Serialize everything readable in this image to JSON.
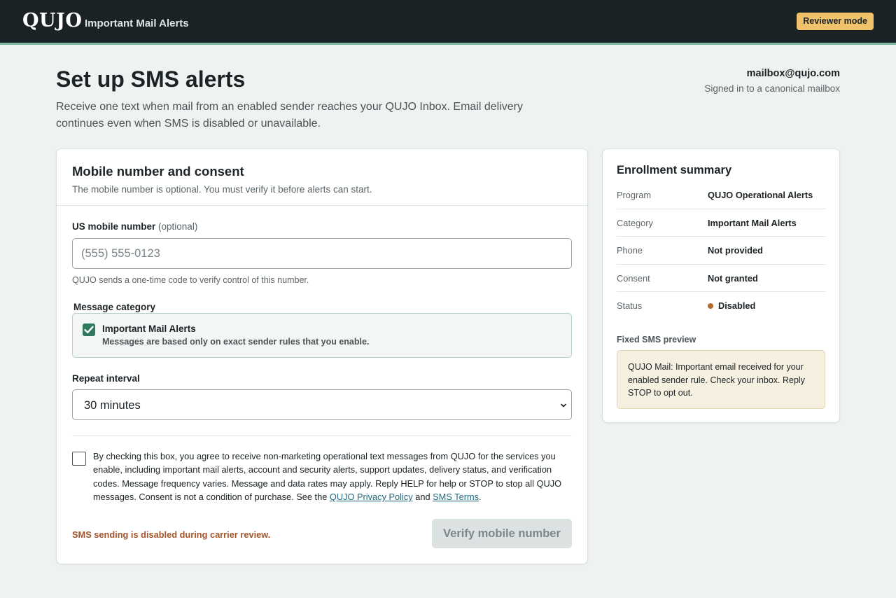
{
  "header": {
    "logo": "QUJO",
    "app_name": "Important Mail Alerts",
    "reviewer_badge": "Reviewer mode",
    "colors": {
      "bar": "#1a2226",
      "accent": "#7fb5a2",
      "badge": "#f0c36b"
    }
  },
  "page": {
    "title": "Set up SMS alerts",
    "description": "Receive one text when mail from an enabled sender reaches your QUJO Inbox. Email delivery continues even when SMS is disabled or unavailable."
  },
  "account": {
    "email": "mailbox@qujo.com",
    "subtitle": "Signed in to a canonical mailbox"
  },
  "form": {
    "title": "Mobile number and consent",
    "subtitle": "The mobile number is optional. You must verify it before alerts can start.",
    "phone_label": "US mobile number",
    "phone_optional": "(optional)",
    "phone_value": "",
    "phone_placeholder": "(555) 555-0123",
    "phone_hint": "QUJO sends a one-time code to verify control of this number.",
    "category_label": "Message category",
    "category": {
      "checked": true,
      "title": "Important Mail Alerts",
      "description": "Messages are based only on exact sender rules that you enable.",
      "check_color": "#2f7a5c"
    },
    "interval_label": "Repeat interval",
    "interval_value": "30 minutes",
    "consent": {
      "checked": false,
      "text_before": "By checking this box, you agree to receive non-marketing operational text messages from QUJO for the services you enable, including important mail alerts, account and security alerts, support updates, delivery status, and verification codes. Message frequency varies. Message and data rates may apply. Reply HELP for help or STOP to stop all QUJO messages. Consent is not a condition of purchase. See the ",
      "privacy_link": "QUJO Privacy Policy",
      "between": " and ",
      "terms_link": "SMS Terms",
      "end": "."
    },
    "warning": "SMS sending is disabled during carrier review.",
    "warning_color": "#a4542a",
    "verify_button": "Verify mobile number"
  },
  "summary": {
    "title": "Enrollment summary",
    "rows": [
      {
        "key": "Program",
        "value": "QUJO Operational Alerts"
      },
      {
        "key": "Category",
        "value": "Important Mail Alerts"
      },
      {
        "key": "Phone",
        "value": "Not provided"
      },
      {
        "key": "Consent",
        "value": "Not granted"
      },
      {
        "key": "Status",
        "value": "Disabled",
        "status_color": "#b06a2c"
      }
    ],
    "preview_label": "Fixed SMS preview",
    "preview_text": "QUJO Mail: Important email received for your enabled sender rule. Check your inbox. Reply STOP to opt out."
  }
}
